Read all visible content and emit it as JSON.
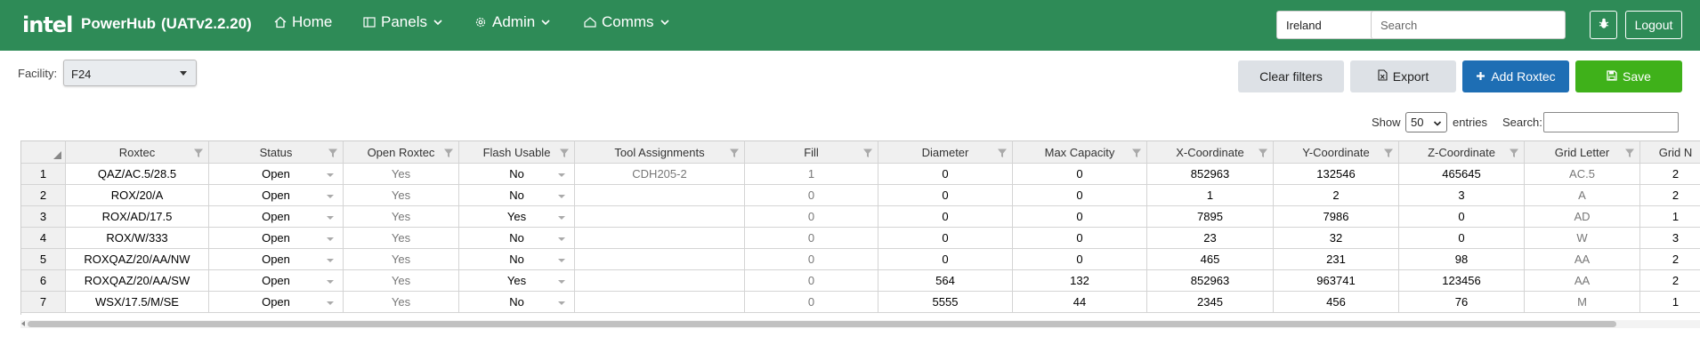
{
  "navbar": {
    "logo_text": "intel",
    "app_name": "PowerHub",
    "version": "(UATv2.2.20)",
    "items": [
      {
        "label": "Home",
        "icon": "home-icon"
      },
      {
        "label": "Panels",
        "icon": "panels-icon"
      },
      {
        "label": "Admin",
        "icon": "gear-icon"
      },
      {
        "label": "Comms",
        "icon": "comms-icon"
      }
    ],
    "region": "Ireland",
    "search_placeholder": "Search",
    "bug_icon": "bug-icon",
    "logout_label": "Logout",
    "color": "#2e8b57"
  },
  "facility": {
    "label": "Facility:",
    "value": "F24"
  },
  "actions": {
    "clear_label": "Clear filters",
    "export_label": "Export",
    "add_label": "Add Roxtec",
    "save_label": "Save",
    "add_color": "#1e6eb4",
    "save_color": "#3fb11a"
  },
  "table_controls": {
    "show_label": "Show",
    "entries_value": "50",
    "entries_label": "entries",
    "search_label": "Search:"
  },
  "grid": {
    "columns": [
      "Roxtec",
      "Status",
      "Open Roxtec",
      "Flash Usable",
      "Tool Assignments",
      "Fill",
      "Diameter",
      "Max Capacity",
      "X-Coordinate",
      "Y-Coordinate",
      "Z-Coordinate",
      "Grid Letter",
      "Grid N"
    ],
    "rows": [
      {
        "n": "1",
        "cells": [
          "QAZ/AC.5/28.5",
          "Open",
          "Yes",
          "No",
          "CDH205-2",
          "1",
          "0",
          "0",
          "852963",
          "132546",
          "465645",
          "AC.5",
          "2"
        ]
      },
      {
        "n": "2",
        "cells": [
          "ROX/20/A",
          "Open",
          "Yes",
          "No",
          "",
          "0",
          "0",
          "0",
          "1",
          "2",
          "3",
          "A",
          "2"
        ]
      },
      {
        "n": "3",
        "cells": [
          "ROX/AD/17.5",
          "Open",
          "Yes",
          "Yes",
          "",
          "0",
          "0",
          "0",
          "7895",
          "7986",
          "0",
          "AD",
          "1"
        ]
      },
      {
        "n": "4",
        "cells": [
          "ROX/W/333",
          "Open",
          "Yes",
          "No",
          "",
          "0",
          "0",
          "0",
          "23",
          "32",
          "0",
          "W",
          "3"
        ]
      },
      {
        "n": "5",
        "cells": [
          "ROXQAZ/20/AA/NW",
          "Open",
          "Yes",
          "No",
          "",
          "0",
          "0",
          "0",
          "465",
          "231",
          "98",
          "AA",
          "2"
        ]
      },
      {
        "n": "6",
        "cells": [
          "ROXQAZ/20/AA/SW",
          "Open",
          "Yes",
          "Yes",
          "",
          "0",
          "564",
          "132",
          "852963",
          "963741",
          "123456",
          "AA",
          "2"
        ]
      },
      {
        "n": "7",
        "cells": [
          "WSX/17.5/M/SE",
          "Open",
          "Yes",
          "No",
          "",
          "0",
          "5555",
          "44",
          "2345",
          "456",
          "76",
          "M",
          "1"
        ]
      }
    ]
  }
}
